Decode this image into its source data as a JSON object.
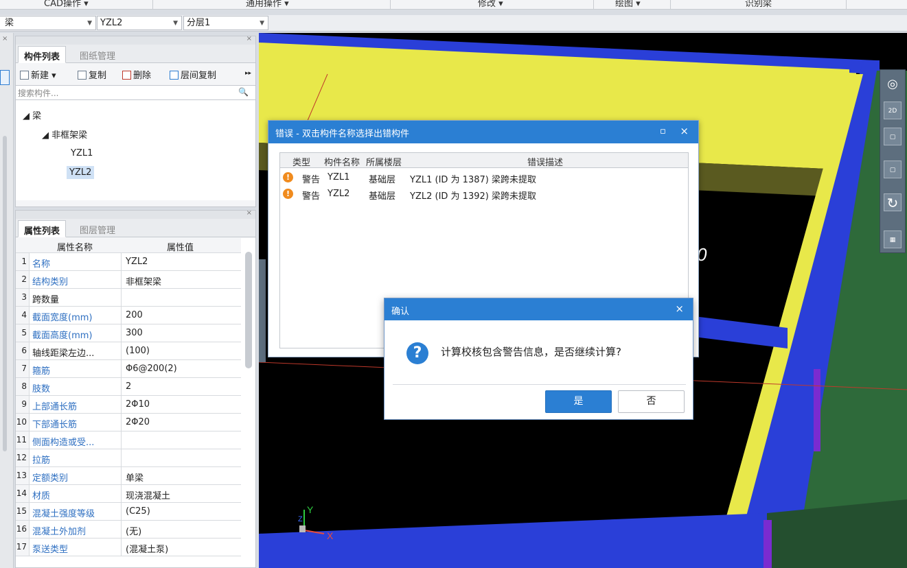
{
  "ribbon": {
    "groups": [
      "CAD操作 ▾",
      "通用操作 ▾",
      "修改 ▾",
      "绘图 ▾",
      "识别梁"
    ]
  },
  "selectors": {
    "category": "梁",
    "component": "YZL2",
    "layer": "分层1"
  },
  "component_panel": {
    "tabs": [
      "构件列表",
      "图纸管理"
    ],
    "toolbar": {
      "new": "新建 ▾",
      "copy": "复制",
      "delete": "删除",
      "floor_copy": "层间复制",
      "more": "▸▸"
    },
    "search_placeholder": "搜索构件...",
    "tree": {
      "root": "◢ 梁",
      "group": "◢ 非框架梁",
      "items": [
        "YZL1",
        "YZL2"
      ]
    }
  },
  "property_panel": {
    "tabs": [
      "属性列表",
      "图层管理"
    ],
    "header": {
      "name": "属性名称",
      "value": "属性值"
    },
    "rows": [
      {
        "n": "1",
        "k": "名称",
        "v": "YZL2",
        "blue": true
      },
      {
        "n": "2",
        "k": "结构类别",
        "v": "非框架梁",
        "blue": true
      },
      {
        "n": "3",
        "k": "跨数量",
        "v": "",
        "blue": false
      },
      {
        "n": "4",
        "k": "截面宽度(mm)",
        "v": "200",
        "blue": true
      },
      {
        "n": "5",
        "k": "截面高度(mm)",
        "v": "300",
        "blue": true
      },
      {
        "n": "6",
        "k": "轴线距梁左边...",
        "v": "(100)",
        "blue": false
      },
      {
        "n": "7",
        "k": "箍筋",
        "v": "Φ6@200(2)",
        "blue": true
      },
      {
        "n": "8",
        "k": "肢数",
        "v": "2",
        "blue": true
      },
      {
        "n": "9",
        "k": "上部通长筋",
        "v": "2Φ10",
        "blue": true
      },
      {
        "n": "10",
        "k": "下部通长筋",
        "v": "2Φ20",
        "blue": true
      },
      {
        "n": "11",
        "k": "侧面构造或受...",
        "v": "",
        "blue": true
      },
      {
        "n": "12",
        "k": "拉筋",
        "v": "",
        "blue": true
      },
      {
        "n": "13",
        "k": "定额类别",
        "v": "单梁",
        "blue": true
      },
      {
        "n": "14",
        "k": "材质",
        "v": "现浇混凝土",
        "blue": true
      },
      {
        "n": "15",
        "k": "混凝土强度等级",
        "v": "(C25)",
        "blue": true
      },
      {
        "n": "16",
        "k": "混凝土外加剂",
        "v": "(无)",
        "blue": true
      },
      {
        "n": "17",
        "k": "泵送类型",
        "v": "(混凝土泵)",
        "blue": true
      }
    ]
  },
  "view3d": {
    "overlay_text": "0",
    "axis_y": "Y",
    "axis_x": "X",
    "z_label": "Z",
    "tool_2d": "2D"
  },
  "error_dialog": {
    "title": "错误 - 双击构件名称选择出错构件",
    "columns": [
      "类型",
      "构件名称",
      "所属楼层",
      "错误描述"
    ],
    "rows": [
      {
        "type": "警告",
        "name": "YZL1",
        "floor": "基础层",
        "desc": "YZL1 (ID 为 1387) 梁跨未提取"
      },
      {
        "type": "警告",
        "name": "YZL2",
        "floor": "基础层",
        "desc": "YZL2 (ID 为 1392) 梁跨未提取"
      }
    ]
  },
  "confirm_dialog": {
    "title": "确认",
    "message": "计算校核包含警告信息，是否继续计算?",
    "yes": "是",
    "no": "否"
  }
}
